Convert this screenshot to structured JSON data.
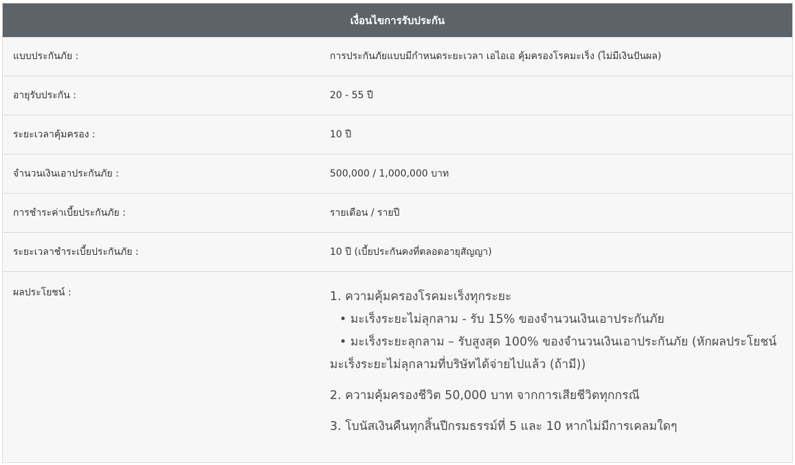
{
  "header": {
    "title": "เงื่อนไขการรับประกัน"
  },
  "rows": [
    {
      "label": "แบบประกันภัย :",
      "value": "การประกันภัยแบบมีกำหนดระยะเวลา เอไอเอ คุ้มครองโรคมะเร็ง (ไม่มีเงินปันผล)"
    },
    {
      "label": "อายุรับประกัน :",
      "value": "20 - 55 ปี"
    },
    {
      "label": "ระยะเวลาคุ้มครอง :",
      "value": "10 ปี"
    },
    {
      "label": "จำนวนเงินเอาประกันภัย :",
      "value": "500,000 / 1,000,000 บาท"
    },
    {
      "label": "การชำระค่าเบี้ยประกันภัย :",
      "value": "รายเดือน / รายปี"
    },
    {
      "label": "ระยะเวลาชำระเบี้ยประกันภัย :",
      "value": "10 ปี (เบี้ยประกันคงที่ตลอดอายุสัญญา)"
    }
  ],
  "benefits": {
    "label": "ผลประโยชน์ :",
    "item1": "1. ความคุ้มครองโรคมะเร็งทุกระยะ",
    "item1_sub1": "• มะเร็งระยะไม่ลุกลาม - รับ 15% ของจำนวนเงินเอาประกันภัย",
    "item1_sub2": "• มะเร็งระยะลุกลาม – รับสูงสุด 100% ของจำนวนเงินเอาประกันภัย (หักผลประโยชน์",
    "item1_sub2_cont": "มะเร็งระยะไม่ลุกลามที่บริษัทได้จ่ายไปแล้ว (ถ้ามี))",
    "item2": "2. ความคุ้มครองชีวิต 50,000 บาท จากการเสียชีวิตทุกกรณี",
    "item3": "3. โบนัสเงินคืนทุกสิ้นปีกรมธรรม์ที่ 5 และ 10 หากไม่มีการเคลมใดๆ"
  }
}
